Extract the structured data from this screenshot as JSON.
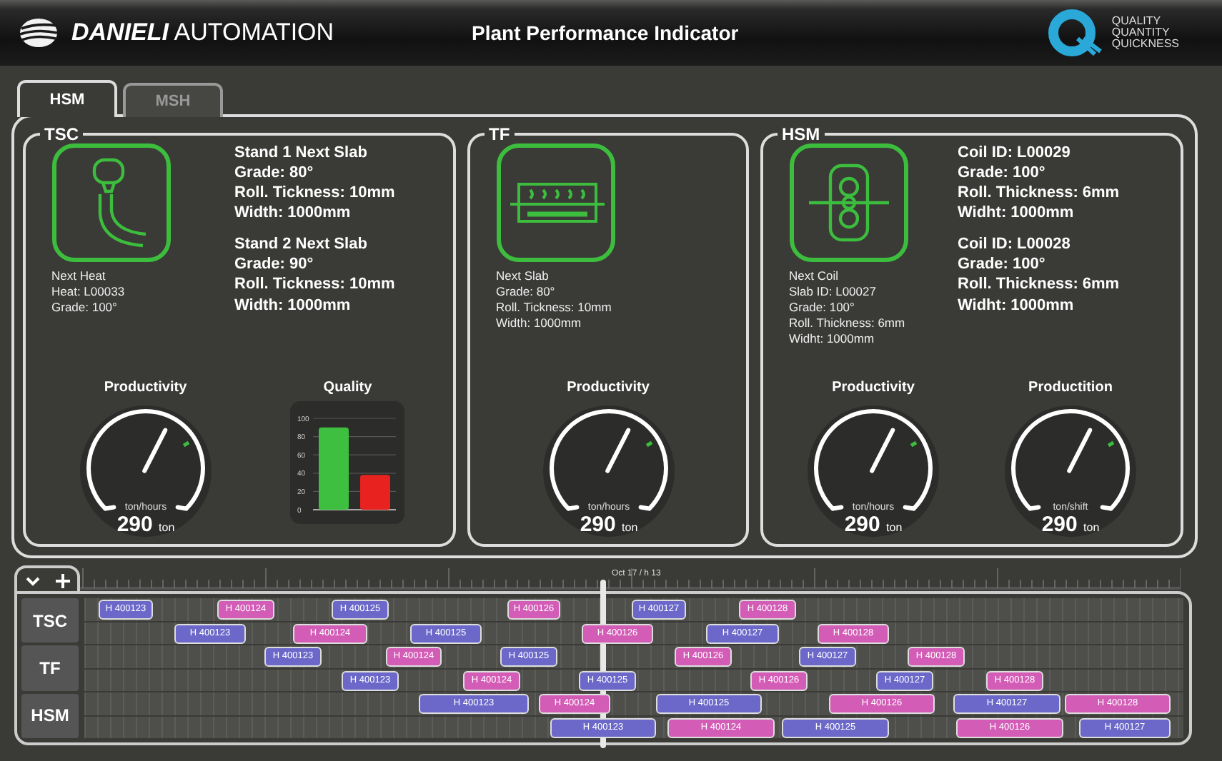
{
  "header": {
    "brand": "DANIELI",
    "brand_suffix": "AUTOMATION",
    "title": "Plant Performance Indicator",
    "tagline": [
      "QUALITY",
      "QUANTITY",
      "QUICKNESS"
    ]
  },
  "tabs": [
    {
      "label": "HSM",
      "selected": true
    },
    {
      "label": "MSH",
      "selected": false
    }
  ],
  "sections": [
    {
      "title": "TSC",
      "caption": [
        "Next Heat",
        "Heat: L00033",
        "Grade: 100°"
      ],
      "details": [
        [
          "Stand 1 Next Slab",
          "Grade: 80°",
          "Roll. Tickness: 10mm",
          "Width: 1000mm"
        ],
        [
          "Stand 2 Next Slab",
          "Grade: 90°",
          "Roll. Tickness: 10mm",
          "Width: 1000mm"
        ]
      ],
      "widgets": [
        {
          "kind": "gauge",
          "title": "Productivity",
          "level": 0.6,
          "unit": "ton/hours",
          "value": "290",
          "value_unit": "ton"
        },
        {
          "kind": "chart",
          "title": "Quality",
          "chart_data": {
            "type": "bar",
            "grid": true,
            "ylim": [
              0,
              100
            ],
            "yticks": [
              0,
              20,
              40,
              60,
              80,
              100
            ],
            "series": [
              {
                "color": "#3fbf3f",
                "values": [
                  90
                ]
              },
              {
                "color": "#e8231f",
                "values": [
                  38
                ]
              }
            ]
          }
        }
      ]
    },
    {
      "title": "TF",
      "caption": [
        "Next Slab",
        "Grade: 80°",
        "Roll. Tickness: 10mm",
        "Width: 1000mm"
      ],
      "widgets": [
        {
          "kind": "gauge",
          "title": "Productivity",
          "level": 0.6,
          "unit": "ton/hours",
          "value": "290",
          "value_unit": "ton"
        }
      ]
    },
    {
      "title": "HSM",
      "caption": [
        "Next Coil",
        "Slab ID: L00027",
        "Grade: 100°",
        "Roll. Thickness: 6mm",
        "Widht: 1000mm"
      ],
      "details": [
        [
          "Coil ID: L00029",
          "Grade: 100°",
          "Roll. Thickness: 6mm",
          "Widht: 1000mm"
        ],
        [
          "Coil ID: L00028",
          "Grade: 100°",
          "Roll. Thickness: 6mm",
          "Widht: 1000mm"
        ]
      ],
      "widgets": [
        {
          "kind": "gauge",
          "title": "Productivity",
          "level": 0.6,
          "unit": "ton/hours",
          "value": "290",
          "value_unit": "ton"
        },
        {
          "kind": "gauge",
          "title": "Productition",
          "level": 0.6,
          "unit": "ton/shift",
          "value": "290",
          "value_unit": "ton"
        }
      ]
    }
  ],
  "timeline": {
    "cursor_label": "Oct 17 / h 13",
    "groups": [
      {
        "label": "TSC",
        "lanes": [
          [
            {
              "label": "H 400123",
              "color": "#6b68c9"
            },
            {
              "label": "H 400124",
              "color": "#d35cb6"
            },
            {
              "label": "H 400125",
              "color": "#6b68c9"
            },
            {
              "label": "H 400126",
              "color": "#d35cb6"
            },
            {
              "label": "H 400127",
              "color": "#6b68c9"
            },
            {
              "label": "H 400128",
              "color": "#d35cb6"
            }
          ],
          [
            {
              "label": "H 400123",
              "color": "#6b68c9"
            },
            {
              "label": "H 400124",
              "color": "#d35cb6"
            },
            {
              "label": "H 400125",
              "color": "#6b68c9"
            },
            {
              "label": "H 400126",
              "color": "#d35cb6"
            },
            {
              "label": "H 400127",
              "color": "#6b68c9"
            },
            {
              "label": "H 400128",
              "color": "#d35cb6"
            }
          ]
        ]
      },
      {
        "label": "TF",
        "lanes": [
          [
            {
              "label": "H 400123",
              "color": "#6b68c9"
            },
            {
              "label": "H 400124",
              "color": "#d35cb6"
            },
            {
              "label": "H 400125",
              "color": "#6b68c9"
            },
            {
              "label": "H 400126",
              "color": "#d35cb6"
            },
            {
              "label": "H 400127",
              "color": "#6b68c9"
            },
            {
              "label": "H 400128",
              "color": "#d35cb6"
            }
          ],
          [
            {
              "label": "H 400123",
              "color": "#6b68c9"
            },
            {
              "label": "H 400124",
              "color": "#d35cb6"
            },
            {
              "label": "H 400125",
              "color": "#6b68c9"
            },
            {
              "label": "H 400126",
              "color": "#d35cb6"
            },
            {
              "label": "H 400127",
              "color": "#6b68c9"
            },
            {
              "label": "H 400128",
              "color": "#d35cb6"
            }
          ]
        ]
      },
      {
        "label": "HSM",
        "lanes": [
          [
            {
              "label": "H 400123",
              "color": "#6b68c9"
            },
            {
              "label": "H 400124",
              "color": "#d35cb6"
            },
            {
              "label": "H 400125",
              "color": "#6b68c9"
            },
            {
              "label": "H 400126",
              "color": "#d35cb6"
            },
            {
              "label": "H 400127",
              "color": "#6b68c9"
            },
            {
              "label": "H 400128",
              "color": "#d35cb6"
            }
          ],
          [
            {
              "label": "H 400123",
              "color": "#6b68c9"
            },
            {
              "label": "H 400124",
              "color": "#d35cb6"
            },
            {
              "label": "H 400125",
              "color": "#6b68c9"
            },
            {
              "label": "H 400126",
              "color": "#d35cb6"
            },
            {
              "label": "H 400127",
              "color": "#6b68c9"
            }
          ]
        ]
      }
    ]
  }
}
